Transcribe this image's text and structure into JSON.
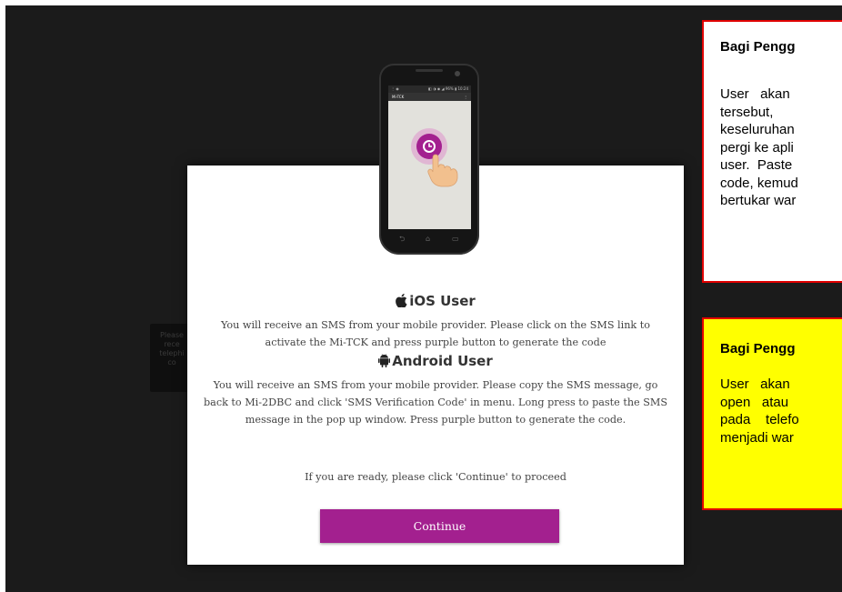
{
  "background_tooltip": {
    "lines": [
      "Please",
      "rece",
      "telephi",
      "co"
    ]
  },
  "phone": {
    "status_left": "⋮ ◉",
    "status_right": "◧ ◑ ◉ ◢ 96% ▮ 10:24",
    "app_title": "Mi-TCK",
    "menu_glyph": "⋮",
    "nav_back": "⮌",
    "nav_home": "⌂",
    "nav_recent": "▭"
  },
  "modal": {
    "ios_title": "iOS User",
    "ios_icon": "apple-icon",
    "ios_text": "You will receive an SMS from your mobile provider. Please click on the SMS link to activate the Mi-TCK and press purple button to generate the code",
    "android_title": "Android User",
    "android_icon": "android-icon",
    "android_text": "You will receive an SMS from your mobile provider. Please copy the SMS message, go back to Mi-2DBC and click 'SMS Verification Code' in menu. Long press to paste the SMS message in the pop up window. Press purple button to generate the code.",
    "ready_text": "If you are ready, please click 'Continue' to proceed",
    "continue_label": "Continue",
    "accent_color": "#a3208f"
  },
  "notes": {
    "red": {
      "title": "Bagi Pengg",
      "lines": [
        "User   akan",
        "tersebut,",
        "keseluruhan",
        "pergi ke apli",
        "user.  Paste",
        "code, kemud",
        "bertukar war"
      ],
      "border_color": "#e00000"
    },
    "yellow": {
      "title": "Bagi Pengg",
      "lines": [
        "User   akan",
        "open   atau",
        "pada    telefo",
        "menjadi war"
      ],
      "background_color": "#ffff00",
      "border_color": "#e00000"
    }
  }
}
